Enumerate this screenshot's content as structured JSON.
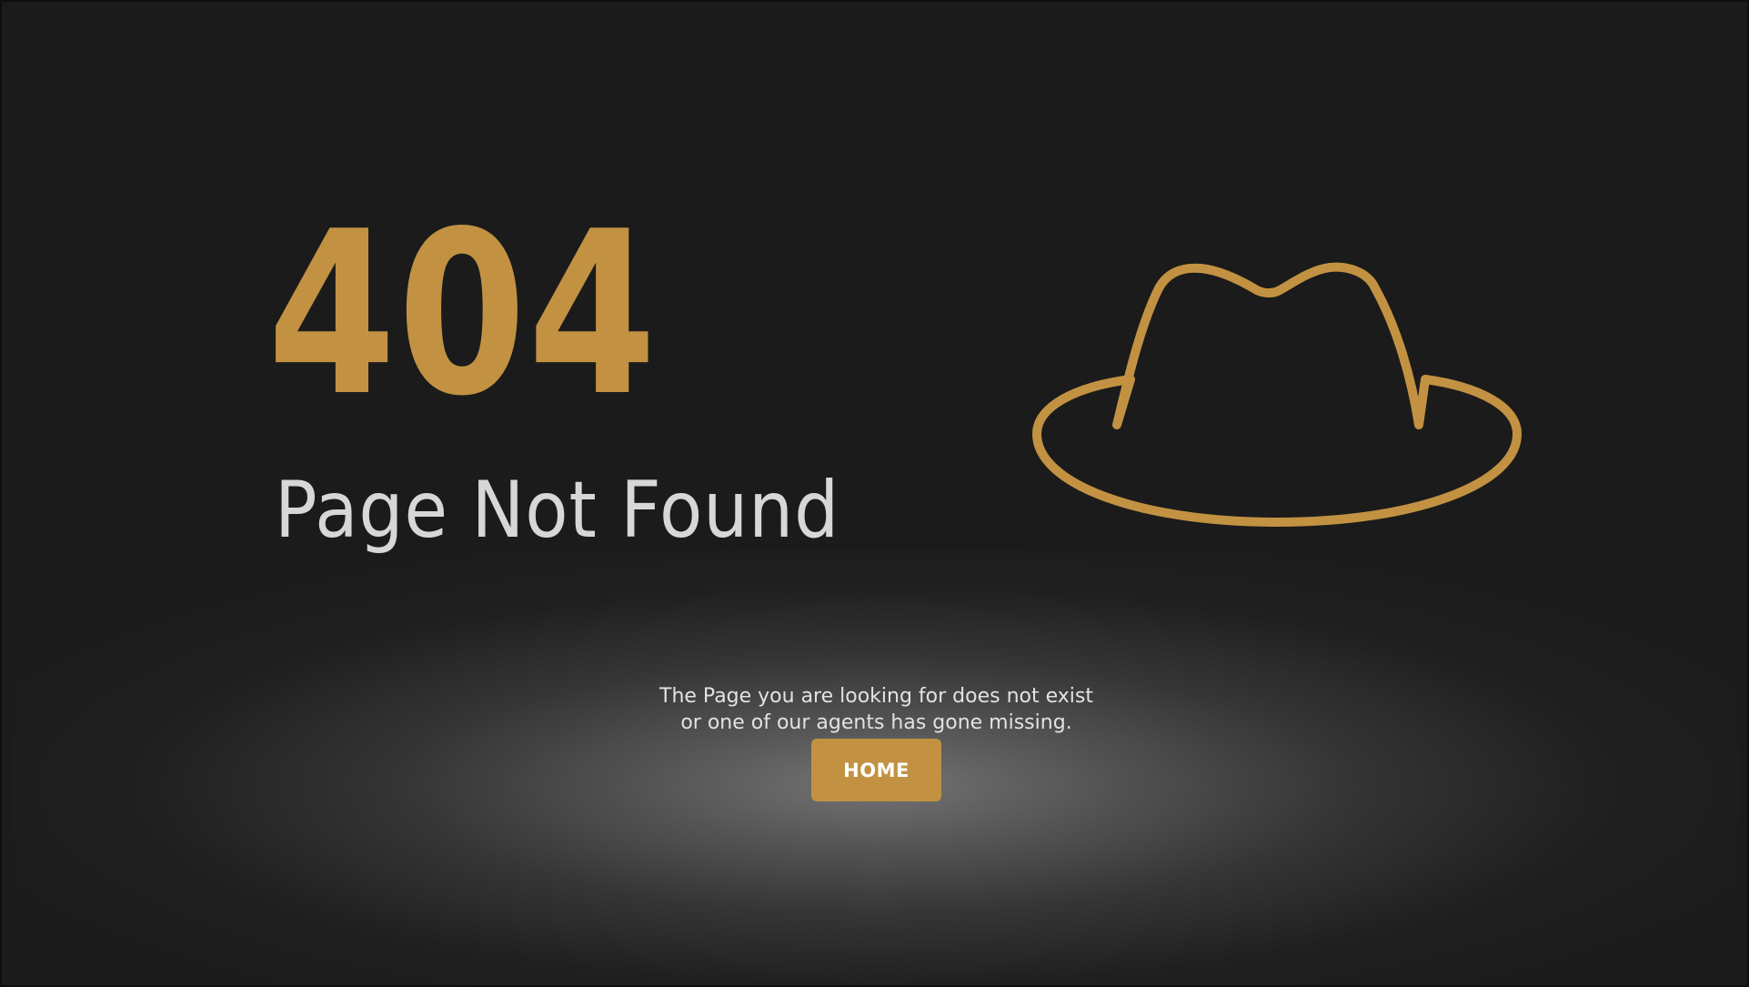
{
  "error": {
    "code": "404",
    "title": "Page Not Found",
    "message_line1": "The Page you are looking for does not exist",
    "message_line2": "or one of our agents has gone missing."
  },
  "actions": {
    "home_label": "HOME"
  },
  "illustration": {
    "icon": "fedora-hat-icon"
  },
  "colors": {
    "background": "#1b1b1b",
    "accent": "#c29242",
    "title_text": "#d7d7d7",
    "body_text": "#e2e2e2",
    "button_text": "#ffffff"
  }
}
